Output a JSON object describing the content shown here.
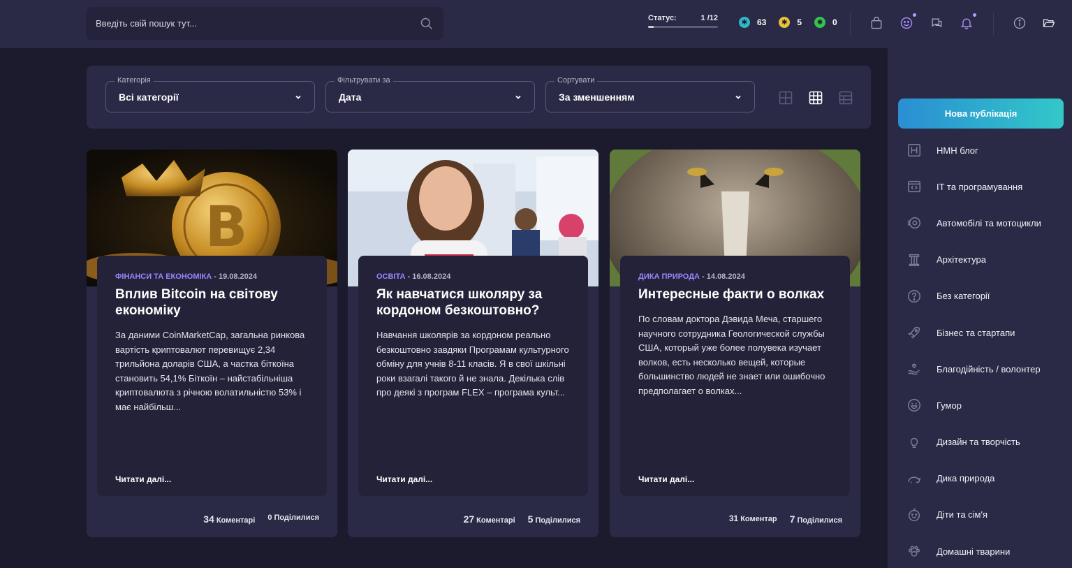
{
  "search": {
    "placeholder": "Введіть свій пошук тут..."
  },
  "status": {
    "label": "Статус:",
    "value": "1 /12",
    "progress": 0.0833
  },
  "coins": [
    {
      "icon": "blue-coin-icon",
      "color": "#2fb7c9",
      "value": "63"
    },
    {
      "icon": "gold-coin-icon",
      "color": "#e8c13a",
      "value": "5"
    },
    {
      "icon": "green-coin-icon",
      "color": "#35c24f",
      "value": "0"
    }
  ],
  "filters": {
    "category": {
      "legend": "Категорія",
      "value": "Всі категорії"
    },
    "filter_by": {
      "legend": "Фільтрувати за",
      "value": "Дата"
    },
    "sort": {
      "legend": "Сортувати",
      "value": "За зменшенням"
    }
  },
  "cards": [
    {
      "category": "ФІНАНСИ ТА ЕКОНОМІКА",
      "date": " - 19.08.2024",
      "title": "Вплив Bitcoin на світову економіку",
      "excerpt": "За даними CoinMarketCap, загальна ринкова вартість криптовалют перевищує 2,34 трильйона доларів США, а частка біткоїна становить 54,1% Біткоїн – найстабільніша криптовалюта з річною волатильністю 53% і має найбільш...",
      "read_more": "Читати далі...",
      "comments_count": "34",
      "comments_label": "Коментарі",
      "shares_count": "0",
      "shares_label": "Поділилися"
    },
    {
      "category": "ОСВІТА",
      "date": " - 16.08.2024",
      "title": "Як навчатися школяру за кордоном безкоштовно?",
      "excerpt": "Навчання школярів за кордоном реально безкоштовно завдяки Програмам культурного обміну для учнів 8-11 класів. Я в свої шкільні роки взагалі такого й не знала. Декілька слів про деякі з програм FLEX – програма культ...",
      "read_more": "Читати далі...",
      "comments_count": "27",
      "comments_label": "Коментарі",
      "shares_count": "5",
      "shares_label": "Поділилися"
    },
    {
      "category": "ДИКА ПРИРОДА",
      "date": " - 14.08.2024",
      "title": "Интересные факти о волках",
      "excerpt": "По словам доктора Дэвида Меча, старшего научного сотрудника Геологической службы США, который уже более полувека изучает волков, есть несколько вещей, которые большинство людей не знает или ошибочно предполагает о волках...",
      "read_more": "Читати далі...",
      "comments_count": "31",
      "comments_label": "Коментар",
      "shares_count": "7",
      "shares_label": "Поділилися"
    }
  ],
  "sidebar": {
    "new_publication": "Нова публікація",
    "categories": [
      {
        "label": "HMH блог",
        "icon": "h-box-icon"
      },
      {
        "label": "IT та програмування",
        "icon": "code-window-icon"
      },
      {
        "label": "Автомобілі та мотоцикли",
        "icon": "wheel-icon"
      },
      {
        "label": "Архітектура",
        "icon": "column-icon"
      },
      {
        "label": "Без категорії",
        "icon": "question-circle-icon"
      },
      {
        "label": "Бізнес та стартапи",
        "icon": "rocket-icon"
      },
      {
        "label": "Благодійність / волонтер",
        "icon": "heart-hand-icon"
      },
      {
        "label": "Гумор",
        "icon": "laugh-face-icon"
      },
      {
        "label": "Дизайн та творчість",
        "icon": "lightbulb-icon"
      },
      {
        "label": "Дика природа",
        "icon": "animal-icon"
      },
      {
        "label": "Діти та сім'я",
        "icon": "baby-face-icon"
      },
      {
        "label": "Домашні тварини",
        "icon": "paw-icon"
      }
    ]
  }
}
